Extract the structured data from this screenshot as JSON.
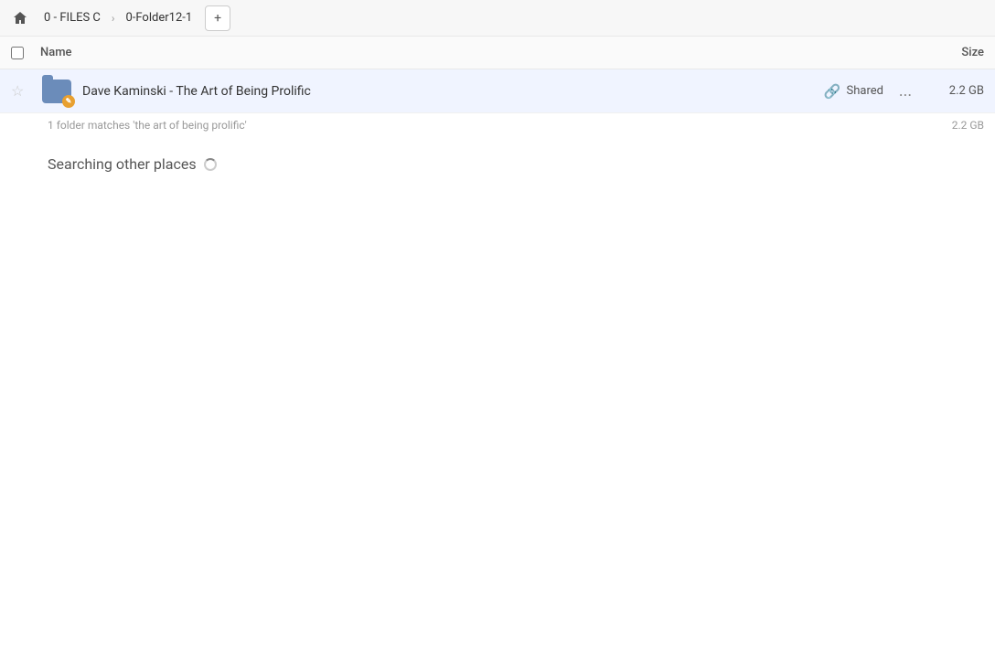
{
  "breadcrumb": {
    "home_label": "Home",
    "items": [
      {
        "label": "0 - FILES C"
      },
      {
        "label": "0-Folder12-1"
      }
    ],
    "add_label": "+"
  },
  "columns": {
    "name_label": "Name",
    "size_label": "Size"
  },
  "file_row": {
    "name": "Dave Kaminski - The Art of Being Prolific",
    "shared_label": "Shared",
    "size": "2.2 GB",
    "more_label": "..."
  },
  "subtitle": {
    "text": "1 folder matches 'the art of being prolific'",
    "size": "2.2 GB"
  },
  "searching": {
    "label": "Searching other places"
  }
}
